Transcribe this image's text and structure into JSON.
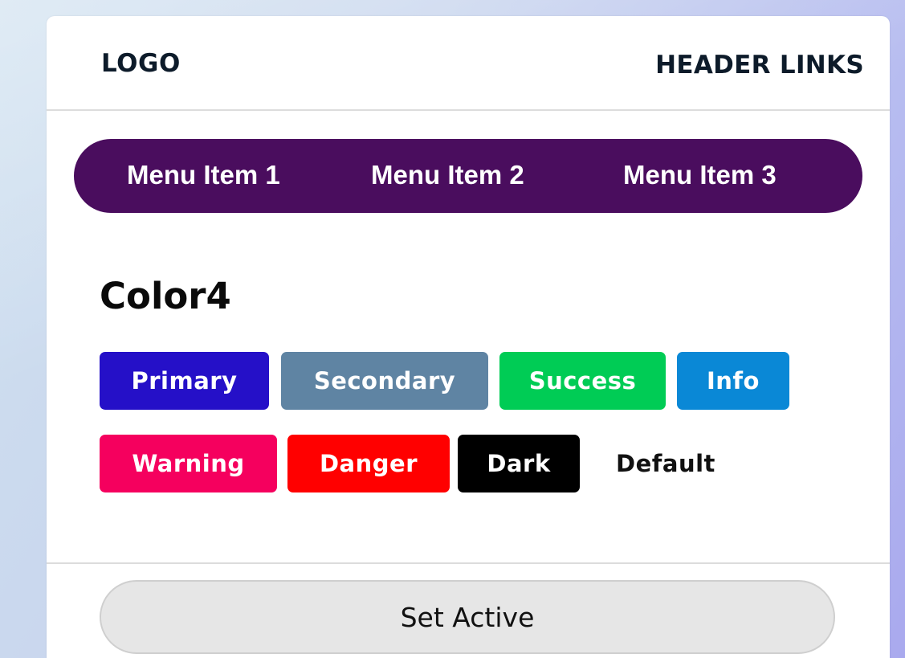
{
  "header": {
    "logo": "LOGO",
    "links": "HEADER LINKS"
  },
  "menu": {
    "items": [
      {
        "label": "Menu Item 1"
      },
      {
        "label": "Menu Item 2"
      },
      {
        "label": "Menu Item 3"
      }
    ],
    "background_color": "#4a0d5e"
  },
  "section": {
    "title": "Color4"
  },
  "badges": [
    {
      "label": "Primary",
      "color": "#2510c8"
    },
    {
      "label": "Secondary",
      "color": "#5f84a3"
    },
    {
      "label": "Success",
      "color": "#00cc55"
    },
    {
      "label": "Info",
      "color": "#0a88d6"
    },
    {
      "label": "Warning",
      "color": "#f5005e"
    },
    {
      "label": "Danger",
      "color": "#ff0000"
    },
    {
      "label": "Dark",
      "color": "#000000"
    },
    {
      "label": "Default",
      "color": "#ffffff"
    }
  ],
  "footer": {
    "button_label": "Set Active"
  }
}
